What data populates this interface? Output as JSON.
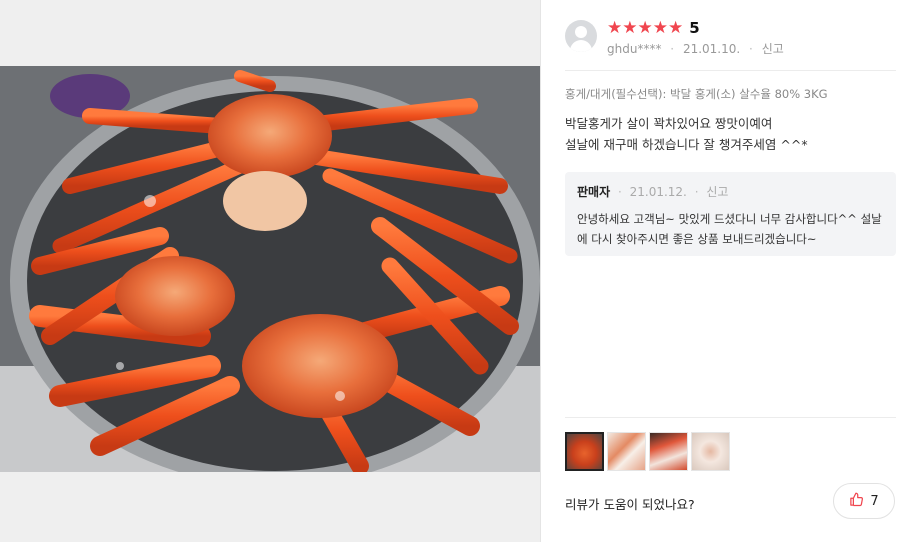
{
  "photo": {
    "alt_icon": "review-photo"
  },
  "review": {
    "stars": [
      "★",
      "★",
      "★",
      "★",
      "★"
    ],
    "rating": "5",
    "user": "ghdu****",
    "date": "21.01.10.",
    "report_label": "신고",
    "option": "홍게/대게(필수선택): 박달 홍게(소) 살수율 80% 3KG",
    "content_line1": "박달홍게가 살이 꽉차있어요 짱맛이예여",
    "content_line2": "설날에 재구매 하겠습니다 잘 챙겨주세염 ^^*"
  },
  "seller_reply": {
    "name": "판매자",
    "date": "21.01.12.",
    "report_label": "신고",
    "text": "안녕하세요 고객님~ 맛있게 드셨다니 너무 감사합니다^^ 설날에 다시 찾아주시면 좋은 상품 보내드리겠습니다~"
  },
  "footer": {
    "helpful_question": "리뷰가 도움이 되었나요?",
    "like_count": "7"
  },
  "colors": {
    "star": "#f0464f",
    "like_icon": "#f0464f"
  }
}
